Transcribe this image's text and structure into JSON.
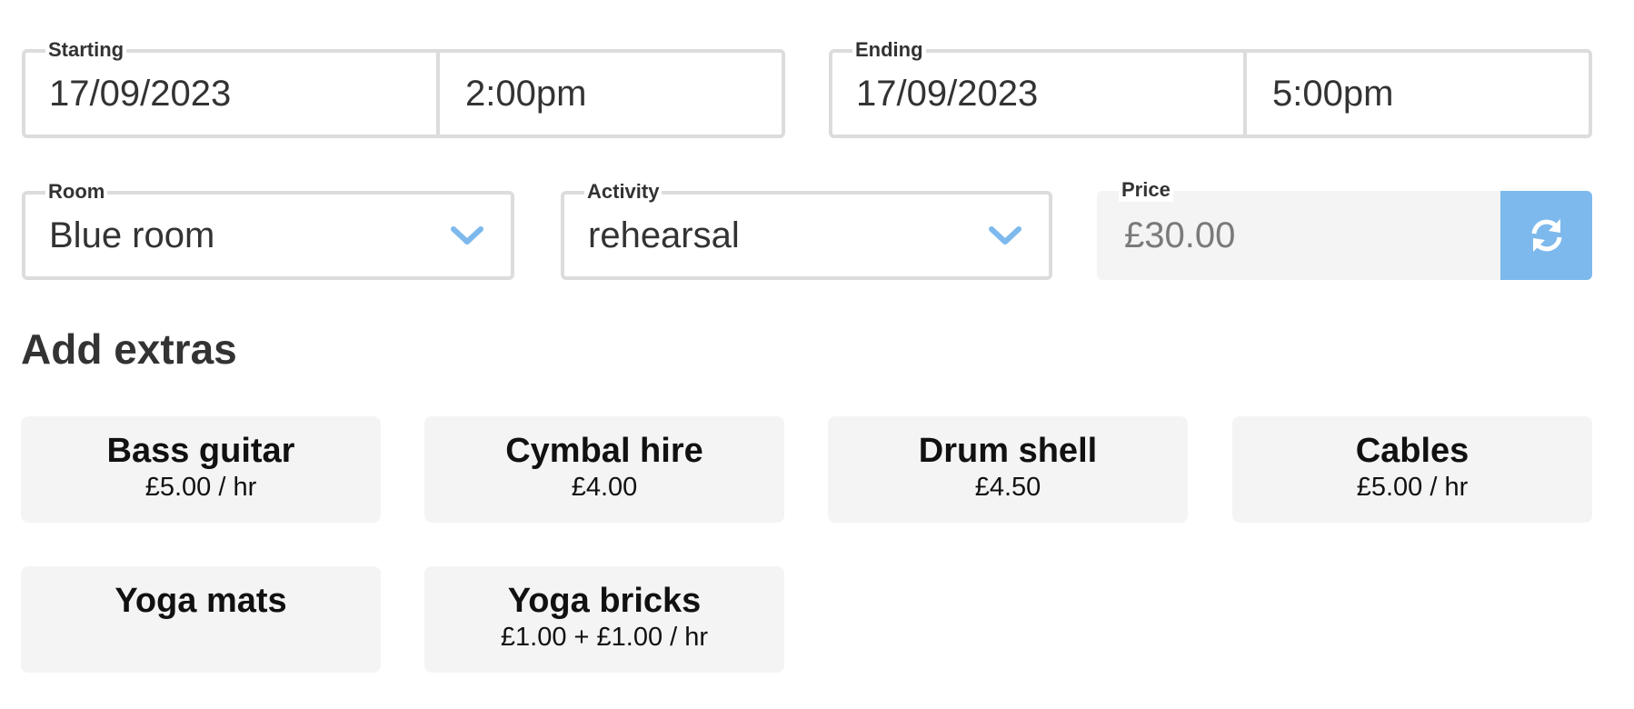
{
  "starting": {
    "label": "Starting",
    "date": "17/09/2023",
    "time": "2:00pm"
  },
  "ending": {
    "label": "Ending",
    "date": "17/09/2023",
    "time": "5:00pm"
  },
  "room": {
    "label": "Room",
    "value": "Blue room"
  },
  "activity": {
    "label": "Activity",
    "value": "rehearsal"
  },
  "price": {
    "label": "Price",
    "value": "£30.00",
    "refresh_icon": "refresh-icon"
  },
  "extras": {
    "heading": "Add extras",
    "items": [
      {
        "name": "Bass guitar",
        "price": "£5.00 / hr"
      },
      {
        "name": "Cymbal hire",
        "price": "£4.00"
      },
      {
        "name": "Drum shell",
        "price": "£4.50"
      },
      {
        "name": "Cables",
        "price": "£5.00 / hr"
      },
      {
        "name": "Yoga mats",
        "price": ""
      },
      {
        "name": "Yoga bricks",
        "price": "£1.00 + £1.00 / hr"
      }
    ]
  },
  "colors": {
    "accent": "#7db9ec",
    "border": "#dcdcdc",
    "card_bg": "#f4f4f4",
    "text": "#333333"
  }
}
